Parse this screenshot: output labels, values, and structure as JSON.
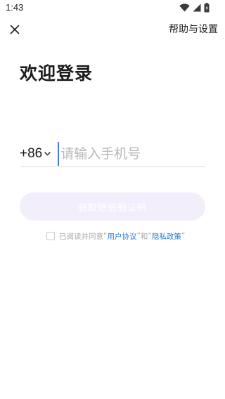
{
  "status_bar": {
    "time": "1:43",
    "icons": [
      "wifi-icon",
      "signal-icon",
      "battery-icon"
    ]
  },
  "header": {
    "close_icon": "close-icon",
    "help_label": "帮助与设置"
  },
  "title": "欢迎登录",
  "phone": {
    "country_code": "+86",
    "placeholder": "请输入手机号",
    "value": ""
  },
  "code_button": {
    "label": "获取短信验证码",
    "enabled": false
  },
  "agreement": {
    "checked": false,
    "prefix": "已阅读并同意",
    "quote_open_1": "“",
    "user_agreement": "用户协议",
    "quote_close_1": "”",
    "and": "和",
    "quote_open_2": "“",
    "privacy_policy": "隐私政策",
    "quote_close_2": "”"
  },
  "colors": {
    "accent_link": "#2b7fd4",
    "cursor": "#4a78f5",
    "button_disabled_bg": "#f3eefc"
  }
}
